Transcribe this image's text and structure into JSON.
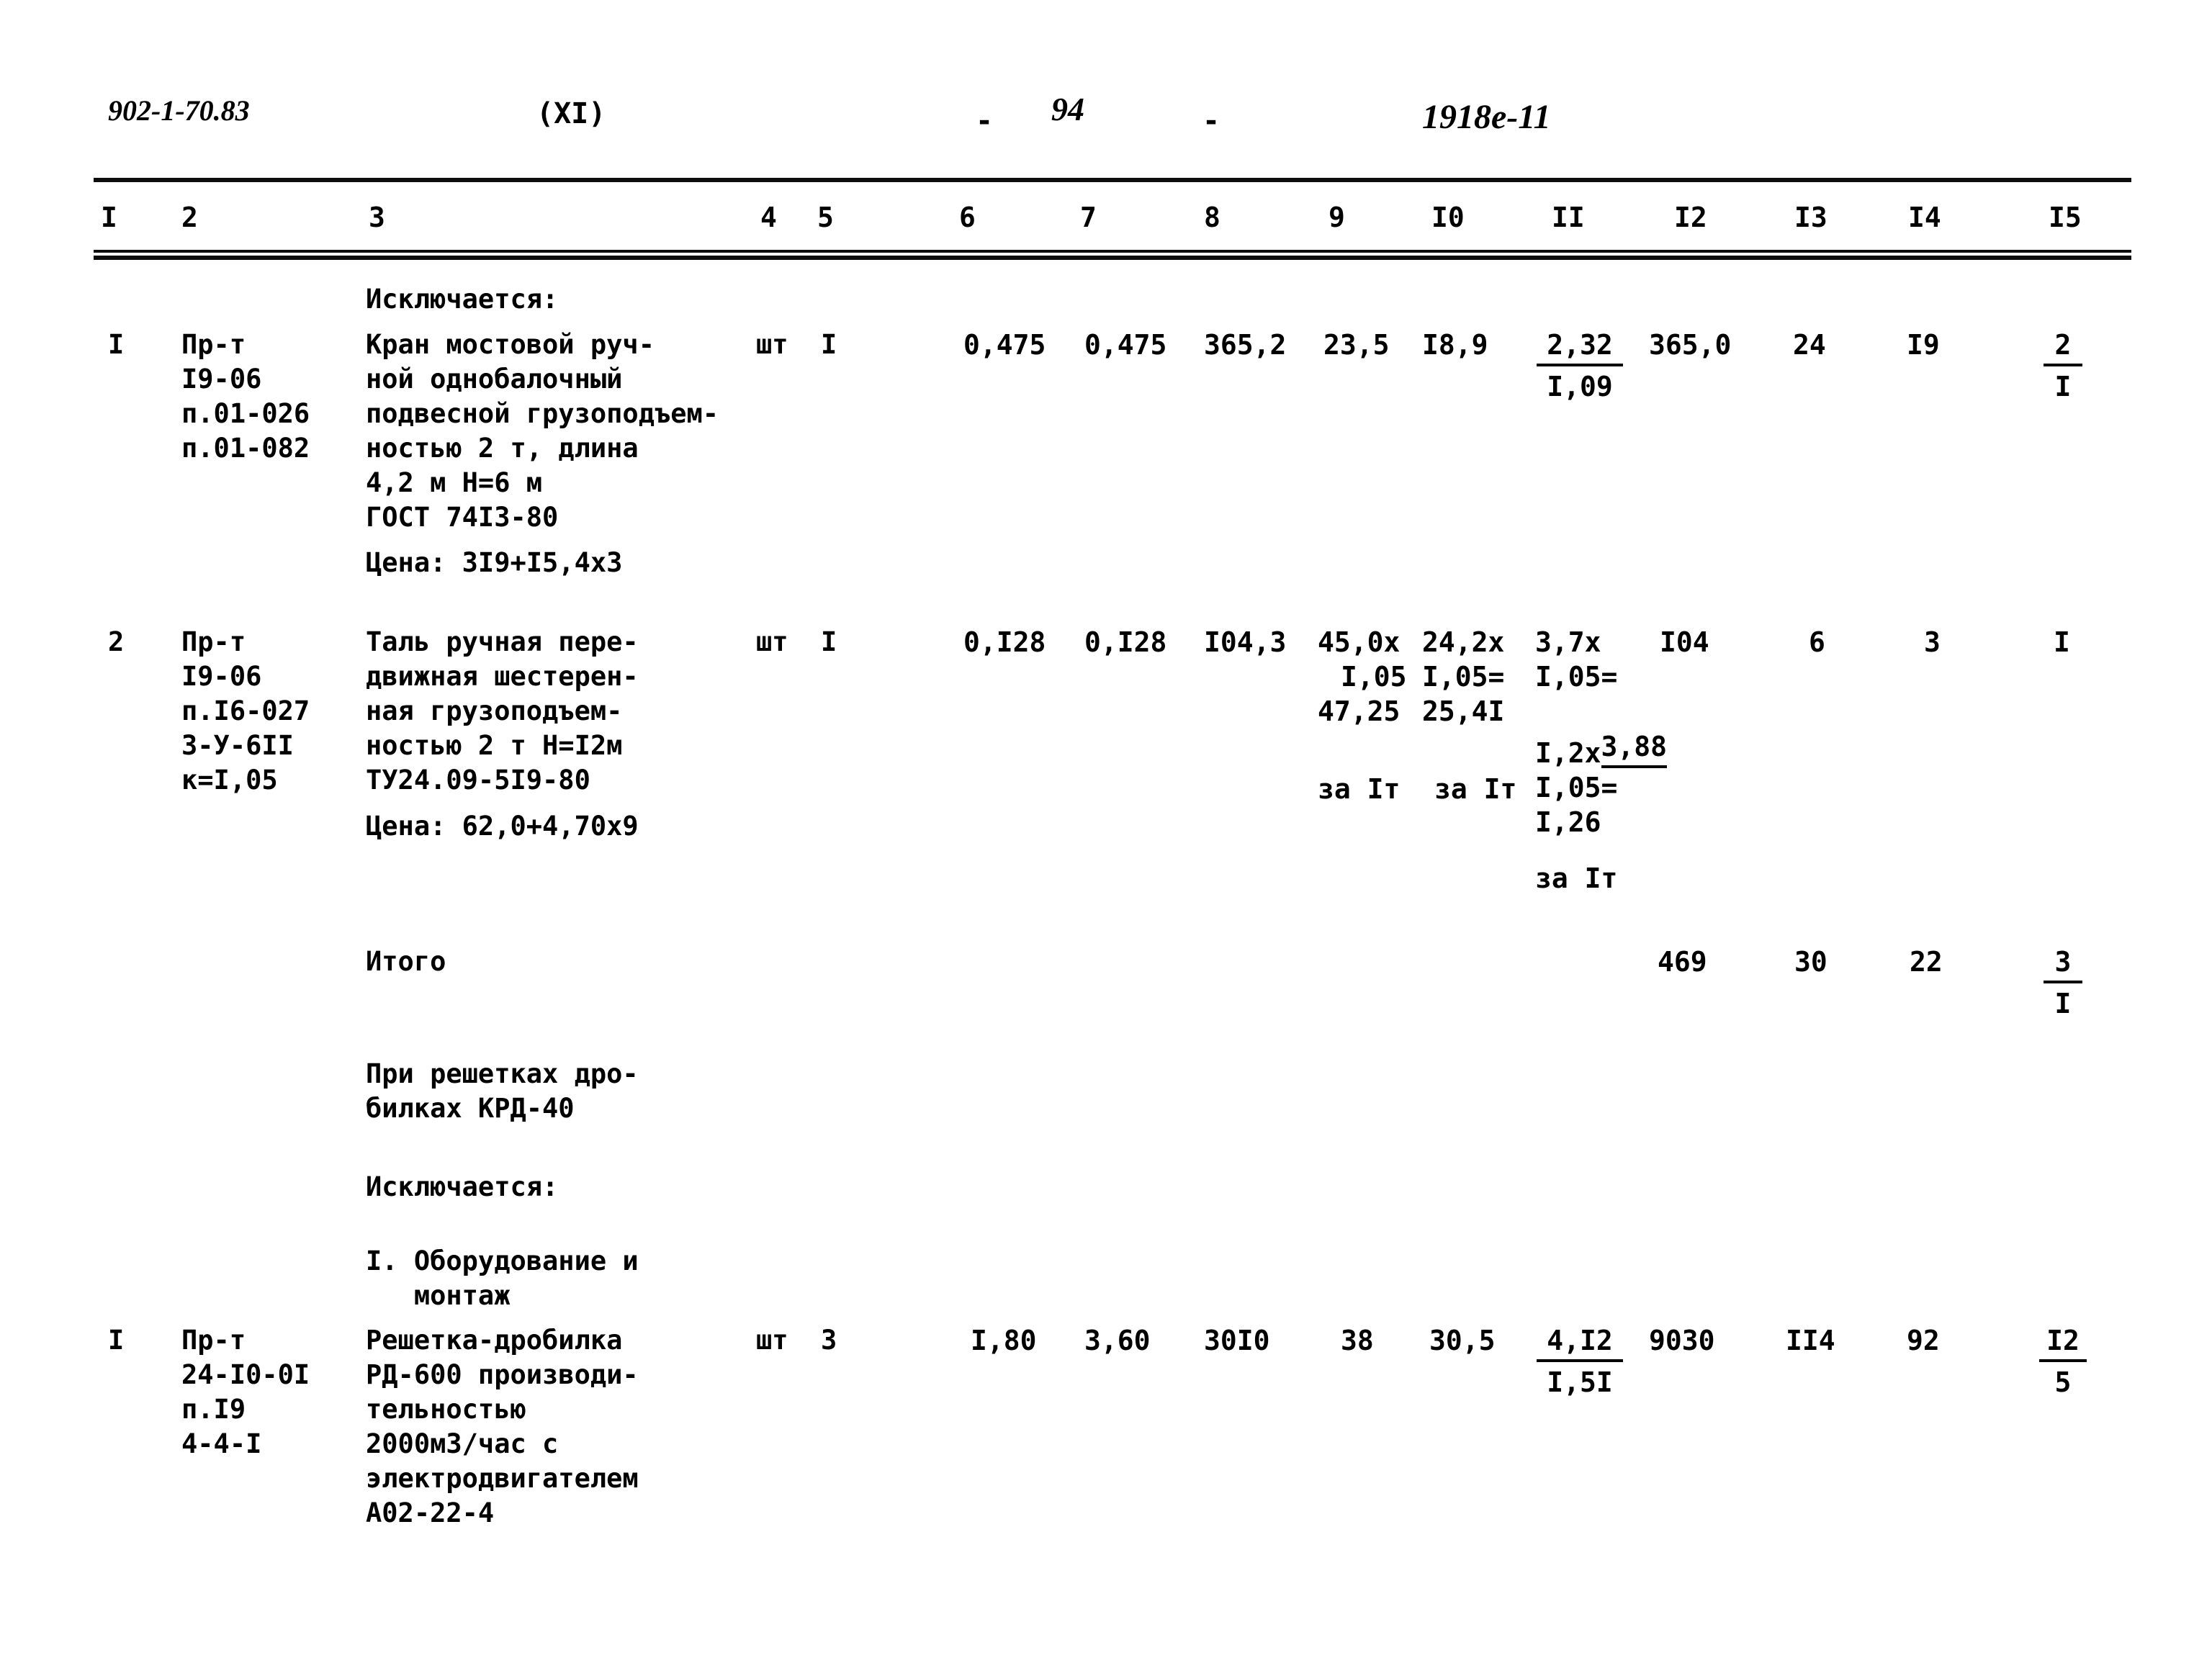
{
  "header": {
    "doc_number": "902-1-70.83",
    "section": "(XI)",
    "page_dash_left": "-",
    "page_number": "94",
    "page_dash_right": "-",
    "handwritten_note": "1918е-11"
  },
  "table": {
    "column_headers": [
      "I",
      "2",
      "3",
      "4",
      "5",
      "6",
      "7",
      "8",
      "9",
      "I0",
      "II",
      "I2",
      "I3",
      "I4",
      "I5"
    ],
    "rows": [
      {
        "kind": "section-label",
        "col3_lines": [
          "Исключается:"
        ]
      },
      {
        "kind": "item",
        "col1": "I",
        "col2_lines": [
          "Пр-т",
          "I9-06",
          "п.01-026",
          "п.01-082"
        ],
        "col3_lines": [
          "Кран мостовой руч-",
          "ной однобалочный",
          "подвесной грузоподъем-",
          "ностью 2 т, длина",
          "4,2 м Н=6 м",
          "ГОСТ 74I3-80"
        ],
        "col3_price": "Цена: 3I9+I5,4х3",
        "col4": "шт",
        "col5": "I",
        "col6": "0,475",
        "col7": "0,475",
        "col8": "365,2",
        "col9": "23,5",
        "col10": "I8,9",
        "col11_frac_top": "2,32",
        "col11_frac_bot": "I,09",
        "col12": "365,0",
        "col13": "24",
        "col14": "I9",
        "col15_frac_top": "2",
        "col15_frac_bot": "I"
      },
      {
        "kind": "item",
        "col1": "2",
        "col2_lines": [
          "Пр-т",
          "I9-06",
          "п.I6-027",
          "3-У-6II",
          "к=I,05"
        ],
        "col3_lines": [
          "Таль ручная пере-",
          "движная шестерен-",
          "ная грузоподъем-",
          "ностью 2 т Н=I2м",
          "ТУ24.09-5I9-80"
        ],
        "col3_price": "Цена: 62,0+4,70х9",
        "col4": "шт",
        "col5": "I",
        "col6": "0,I28",
        "col7": "0,I28",
        "col8": "I04,3",
        "col9_lines": [
          "45,0х",
          "I,05",
          "47,25"
        ],
        "col9_note": "за Iт",
        "col10_lines": [
          "24,2х",
          "I,05=",
          "25,4I"
        ],
        "col10_note": "за Iт",
        "col11_lines": [
          "3,7х",
          "I,05=",
          "3,88"
        ],
        "col11_lines2": [
          "I,2х",
          "I,05=",
          "I,26"
        ],
        "col11_note": "за Iт",
        "col12": "I04",
        "col13": "6",
        "col14": "3",
        "col15": "I"
      },
      {
        "kind": "total",
        "label": "Итого",
        "col12": "469",
        "col13": "30",
        "col14": "22",
        "col15_frac_top": "3",
        "col15_frac_bot": "I"
      },
      {
        "kind": "note",
        "col3_lines": [
          "При решетках дро-",
          "билках КРД-40"
        ]
      },
      {
        "kind": "section-label",
        "col3_lines": [
          "Исключается:"
        ]
      },
      {
        "kind": "subheading",
        "col3_lines": [
          "I. Оборудование и",
          "   монтаж"
        ]
      },
      {
        "kind": "item",
        "col1": "I",
        "col2_lines": [
          "Пр-т",
          "24-I0-0I",
          "п.I9",
          "4-4-I"
        ],
        "col3_lines": [
          "Решетка-дробилка",
          "РД-600 производи-",
          "тельностью",
          "2000м3/час с",
          "электродвигателем",
          "А02-22-4"
        ],
        "col4": "шт",
        "col5": "3",
        "col6": "I,80",
        "col7": "3,60",
        "col8": "30I0",
        "col9": "38",
        "col10": "30,5",
        "col11_frac_top": "4,I2",
        "col11_frac_bot": "I,5I",
        "col12": "9030",
        "col13": "II4",
        "col14": "92",
        "col15_frac_top": "I2",
        "col15_frac_bot": "5"
      }
    ]
  }
}
